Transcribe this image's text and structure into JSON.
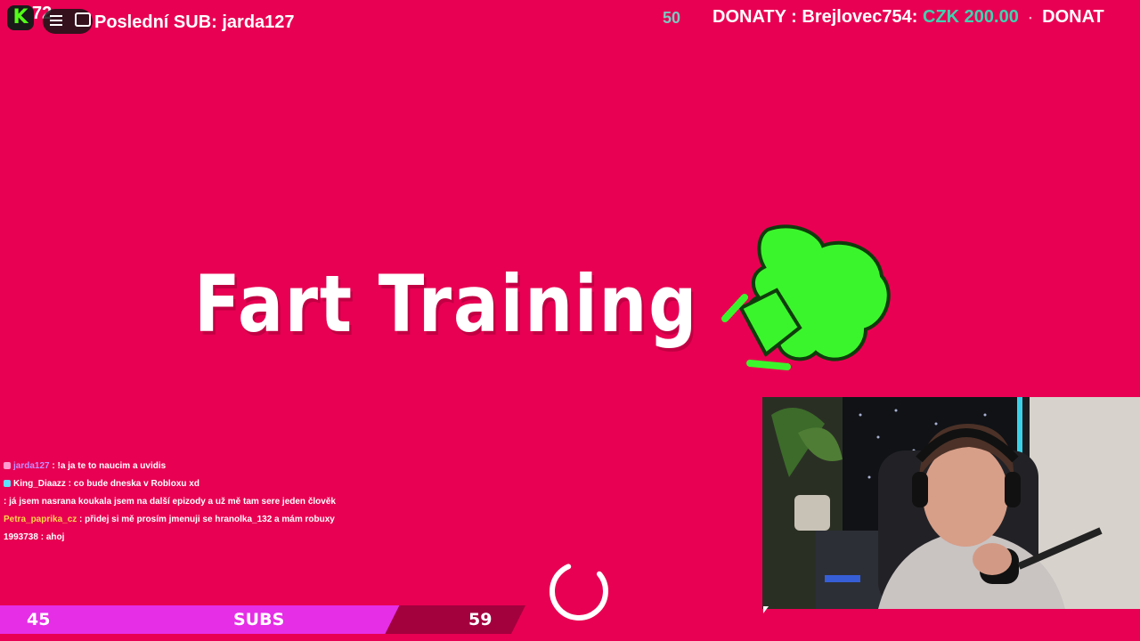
{
  "overlay": {
    "kick_logo": "K",
    "viewer_count": "72",
    "last_sub_text": "Poslední SUB: jarda127"
  },
  "ticker": {
    "number": "50",
    "label": "DONATY : Brejlovec754:",
    "amount": "CZK 200.00",
    "repeat_label": "DONAT"
  },
  "title": "Fart Training",
  "icons": {
    "fart_icon": "fart-cloud-icon",
    "spinner": "loading-spinner-icon",
    "menu": "menu-icon",
    "chat": "chat-bubble-icon"
  },
  "colors": {
    "background": "#e80052",
    "fart_green": "#3bf52c",
    "sub_bar_fill": "#e52ee6",
    "sub_bar_track": "#a3003e"
  },
  "chat": [
    {
      "user": "jarda127",
      "user_color": "#c58cff",
      "badge_color": "#ff9bd0",
      "text": "!a ja te to naucim a uvidis"
    },
    {
      "user": "King_Diaazz",
      "user_color": "#ffffff",
      "badge_color": "#5ee0ff",
      "text": "co bude dneska v Robloxu xd"
    },
    {
      "user": "",
      "user_color": "#ff8fb0",
      "badge_color": "",
      "text": "já jsem nasrana koukala jsem na další epizody a už mě tam sere jeden člověk"
    },
    {
      "user": "Petra_paprika_cz",
      "user_color": "#ffd84a",
      "badge_color": "",
      "text": "přidej si mě prosím jmenuji se hranolka_132 a mám robuxy"
    },
    {
      "user": "1993738",
      "user_color": "#ffffff",
      "badge_color": "",
      "text": "ahoj"
    }
  ],
  "sub_goal": {
    "current": "45",
    "label": "SUBS",
    "target": "59",
    "progress": 0.76
  }
}
